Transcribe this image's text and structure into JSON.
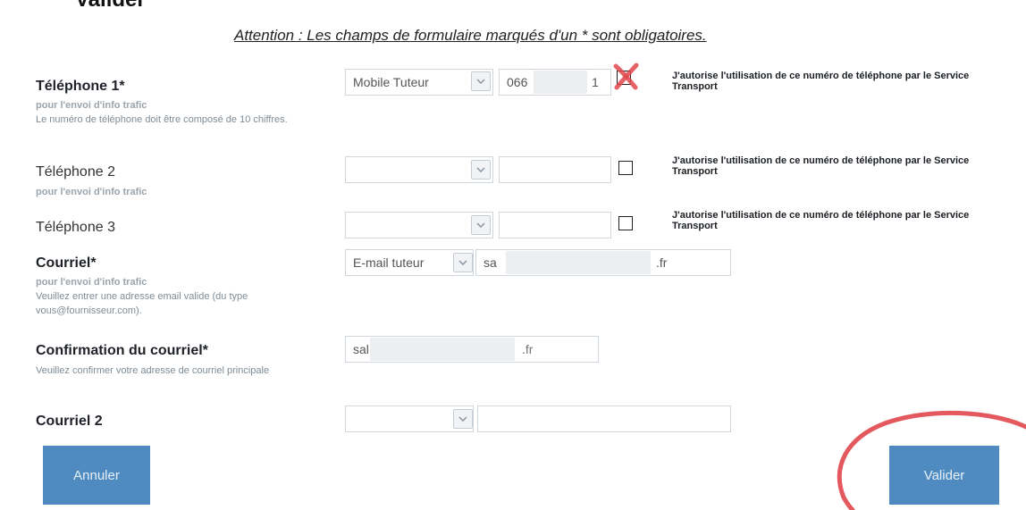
{
  "page": {
    "top_title": "Valider"
  },
  "notice": "Attention : Les champs de formulaire marqués d'un * sont obligatoires.",
  "phone1": {
    "label": "Téléphone 1*",
    "hint_bold": "pour l'envoi d'info trafic",
    "hint_text": "Le numéro de téléphone doit être composé de 10 chiffres.",
    "type_value": "Mobile Tuteur",
    "number_prefix": "066",
    "number_suffix": "1",
    "consent": "J'autorise l'utilisation de ce numéro de téléphone par le Service Transport",
    "checked": true
  },
  "phone2": {
    "label": "Téléphone 2",
    "hint_bold": "pour l'envoi d'info trafic",
    "type_value": "",
    "number": "",
    "consent": "J'autorise l'utilisation de ce numéro de téléphone par le Service Transport",
    "checked": false
  },
  "phone3": {
    "label": "Téléphone 3",
    "type_value": "",
    "number": "",
    "consent": "J'autorise l'utilisation de ce numéro de téléphone par le Service Transport",
    "checked": false
  },
  "email": {
    "label": "Courriel*",
    "hint_bold": "pour l'envoi d'info trafic",
    "hint_text": "Veuillez entrer une adresse email valide (du type vous@fournisseur.com).",
    "type_value": "E-mail tuteur",
    "value_prefix": "sa",
    "value_suffix": ".fr"
  },
  "email_confirm": {
    "label": "Confirmation du courriel*",
    "hint_text": "Veuillez confirmer votre adresse de courriel principale",
    "value_prefix": "sal",
    "value_suffix": ".fr"
  },
  "email2": {
    "label": "Courriel 2",
    "type_value": "",
    "value": ""
  },
  "buttons": {
    "cancel": "Annuler",
    "submit": "Valider"
  },
  "colors": {
    "button": "#4f8bc0",
    "annotation": "#e0474c"
  }
}
